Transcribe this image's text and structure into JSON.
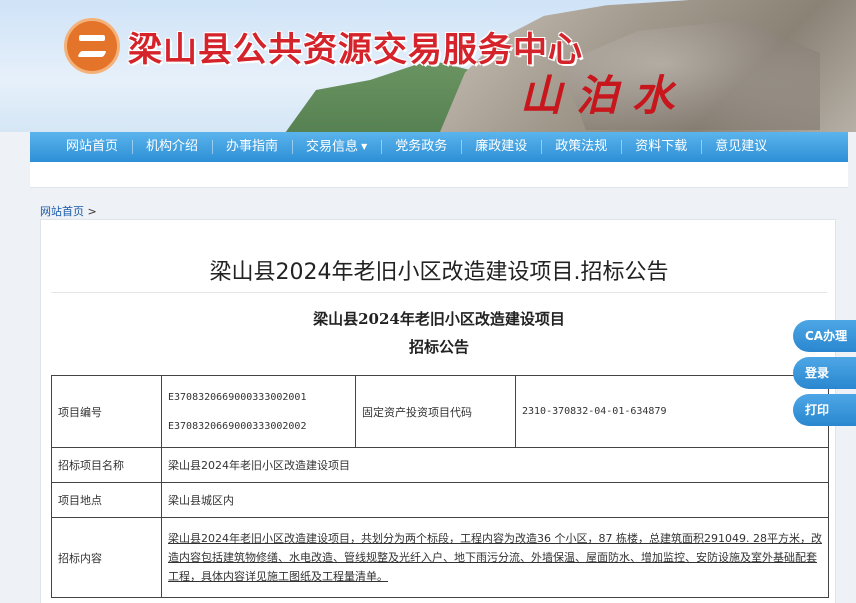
{
  "header": {
    "site_title": "梁山县公共资源交易服务中心",
    "calligraphy": "山泊水"
  },
  "nav": {
    "items": [
      "网站首页",
      "机构介绍",
      "办事指南",
      "交易信息",
      "党务政务",
      "廉政建设",
      "政策法规",
      "资料下载",
      "意见建议"
    ],
    "dropdown_caret": "▼"
  },
  "breadcrumb": {
    "home": "网站首页",
    "separator": ">"
  },
  "article": {
    "title": "梁山县2024年老旧小区改造建设项目.招标公告",
    "subtitle_line1": "梁山县2024年老旧小区改造建设项目",
    "subtitle_line2": "招标公告"
  },
  "table": {
    "row1": {
      "label": "项目编号",
      "code1": "E3708320669000333002001",
      "code2": "E3708320669000333002002",
      "label2": "固定资产投资项目代码",
      "value2": "2310-370832-04-01-634879"
    },
    "row2": {
      "label": "招标项目名称",
      "value": "梁山县2024年老旧小区改造建设项目"
    },
    "row3": {
      "label": "项目地点",
      "value": "梁山县城区内"
    },
    "row4": {
      "label": "招标内容",
      "value": "梁山县2024年老旧小区改造建设项目，共划分为两个标段，工程内容为改造36 个小区，87 栋楼，总建筑面积291049.    28平方米，改造内容包括建筑物修缮、水电改造、管线规整及光纤入户、地下雨污分流、外墙保温、屋面防水、增加监控、安防设施及室外基础配套工程，具体内容详见施工图纸及工程量清单。"
    }
  },
  "side_buttons": {
    "ca": "CA办理",
    "login": "登录",
    "print": "打印"
  },
  "colors": {
    "nav_blue": "#2d8fd6",
    "title_red": "#d4232a",
    "link_blue": "#1a5aa8"
  }
}
